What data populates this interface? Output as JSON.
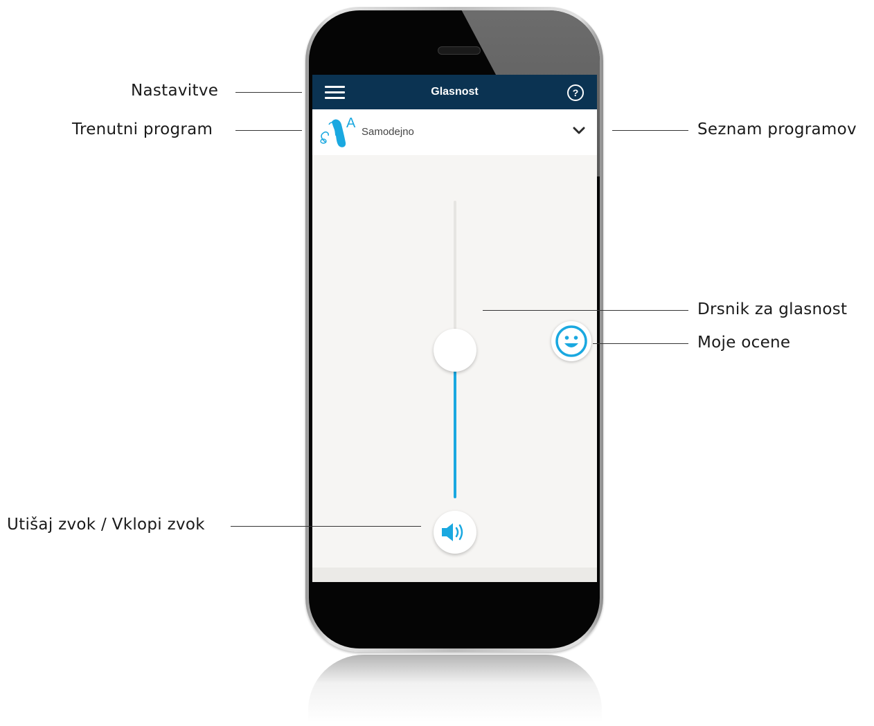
{
  "app": {
    "title": "Glasnost",
    "help_label": "?",
    "current_program": "Samodejno",
    "program_badge": "A"
  },
  "volume_slider": {
    "level": 0.49
  },
  "icons": {
    "menu": "hamburger-menu-icon",
    "help": "question-circle-icon",
    "program": "hearing-aid-icon",
    "dropdown": "chevron-down-icon",
    "rating": "smiley-face-icon",
    "mute": "speaker-volume-icon"
  },
  "colors": {
    "header": "#0b3352",
    "accent": "#1aa8e0",
    "screen_bg": "#f6f5f3"
  },
  "annotations": {
    "settings": "Nastavitve",
    "current_program": "Trenutni program",
    "program_list": "Seznam programov",
    "volume_slider": "Drsnik za glasnost",
    "my_ratings": "Moje ocene",
    "mute_unmute": "Utišaj zvok / Vklopi zvok"
  }
}
